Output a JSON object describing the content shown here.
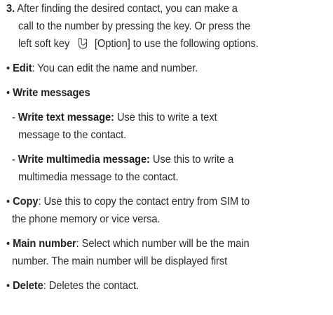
{
  "step3": {
    "number": "3.",
    "line1": "After finding the desired contact, you can make a",
    "line2": "call to the number by pressing the key. Or press the",
    "line3_before": "left soft key",
    "line3_after": "[Option] to use the following options.",
    "softkey_icon": "left-soft-key-icon"
  },
  "options": {
    "edit": {
      "bullet": "•",
      "term": "Edit",
      "text": ": You can edit the name and number."
    },
    "write_messages": {
      "bullet": "•",
      "term": "Write messages"
    },
    "write_text": {
      "dash": "- ",
      "term": "Write text message:",
      "line1": " Use this to write a text",
      "line2": "message to the contact."
    },
    "write_multimedia": {
      "dash": "- ",
      "term": "Write multimedia message:",
      "line1": " Use this to write a",
      "line2": "multimedia message to the contact."
    },
    "copy": {
      "bullet": "•",
      "term": "Copy",
      "line1": ": Use this to copy the contact entry from SIM to",
      "line2": "the phone memory or vice versa."
    },
    "main_number": {
      "bullet": "•",
      "term": "Main number",
      "line1": ": Select which number will be the main",
      "line2": "number. The main number will be displayed first"
    },
    "delete": {
      "bullet": "•",
      "term": "Delete",
      "text": ": Deletes the contact."
    }
  }
}
